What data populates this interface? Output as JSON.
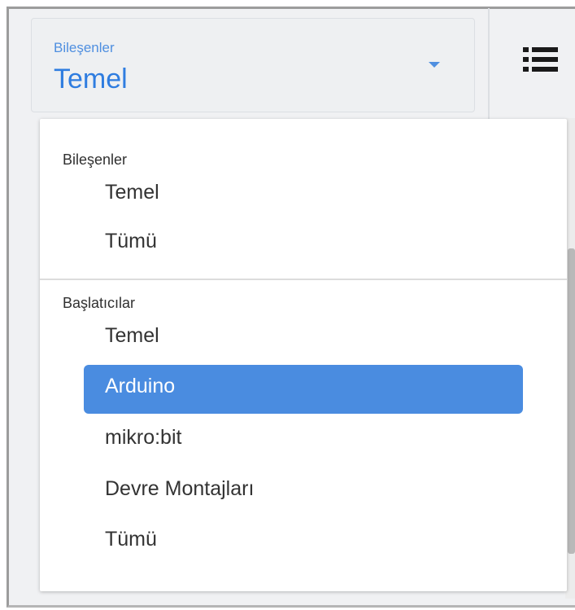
{
  "select": {
    "label": "Bileşenler",
    "value": "Temel"
  },
  "toolbar": {
    "list_icon": "list-icon"
  },
  "menu": {
    "groups": [
      {
        "header": "Bileşenler",
        "items": [
          {
            "label": "Temel"
          },
          {
            "label": "Tümü"
          }
        ]
      },
      {
        "header": "Başlatıcılar",
        "items": [
          {
            "label": "Temel"
          },
          {
            "label": "Arduino",
            "selected": true
          },
          {
            "label": "mikro:bit"
          },
          {
            "label": "Devre Montajları"
          },
          {
            "label": "Tümü"
          }
        ]
      }
    ]
  },
  "colors": {
    "accent": "#2f7de0",
    "selected_bg": "#4a8ce0"
  }
}
